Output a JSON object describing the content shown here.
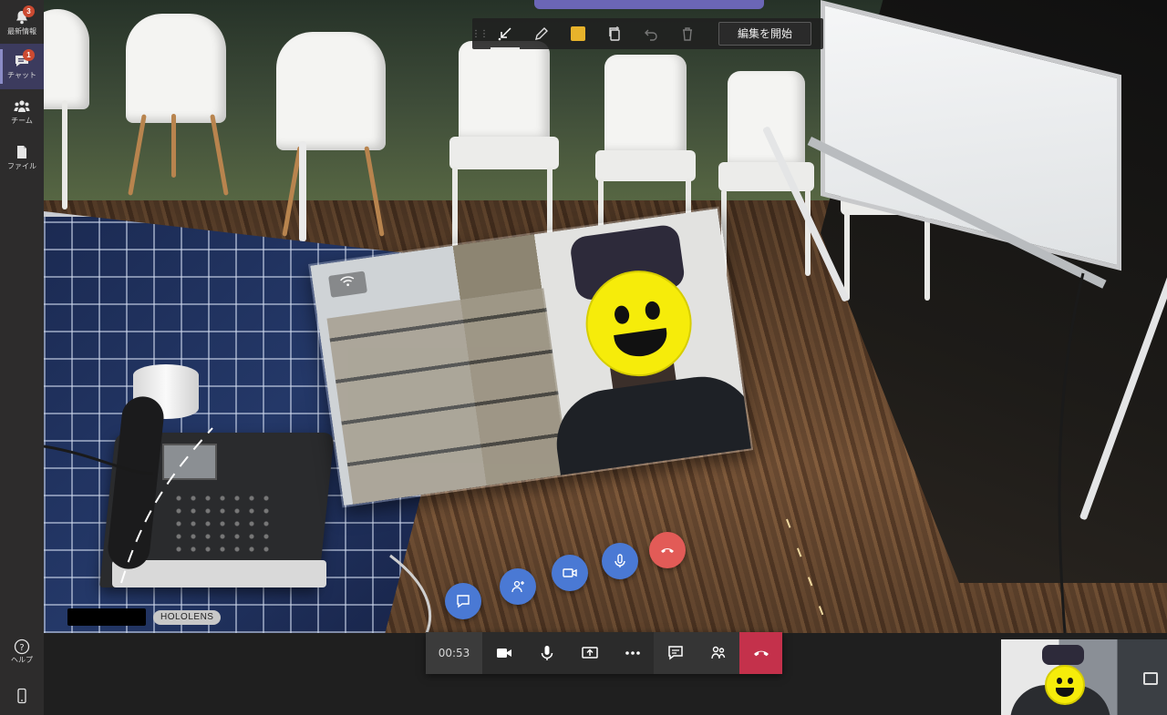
{
  "rail": {
    "items": [
      {
        "label": "最新情報",
        "icon": "bell-icon",
        "badge": "3"
      },
      {
        "label": "チャット",
        "icon": "chat-icon",
        "badge": "1",
        "active": true
      },
      {
        "label": "チーム",
        "icon": "teams-icon"
      },
      {
        "label": "ファイル",
        "icon": "file-icon"
      }
    ],
    "help_label": "ヘルプ",
    "device_icon": "mobile-device-icon"
  },
  "ink_toolbar": {
    "tools": [
      "arrow-icon",
      "pen-icon",
      "color-swatch",
      "copy-icon",
      "undo-icon",
      "trash-icon"
    ],
    "swatch_color": "#e7b32b",
    "edit_button": "編集を開始"
  },
  "scene": {
    "participant_tag": "HOLOLENS",
    "remote_controls": [
      "chat-icon",
      "add-people-icon",
      "video-icon",
      "mic-icon",
      "hang-up-icon"
    ]
  },
  "call_bar": {
    "timer": "00:53",
    "buttons": [
      "video-icon",
      "mic-icon",
      "share-screen-icon",
      "more-icon",
      "chat-icon",
      "participants-icon",
      "hang-up-icon"
    ],
    "hang_up_color": "#c4314b"
  },
  "colors": {
    "accent": "#6b66b6",
    "holo_button": "#4a79d4",
    "holo_hangup": "#e25b57",
    "badge": "#cc4a31"
  }
}
